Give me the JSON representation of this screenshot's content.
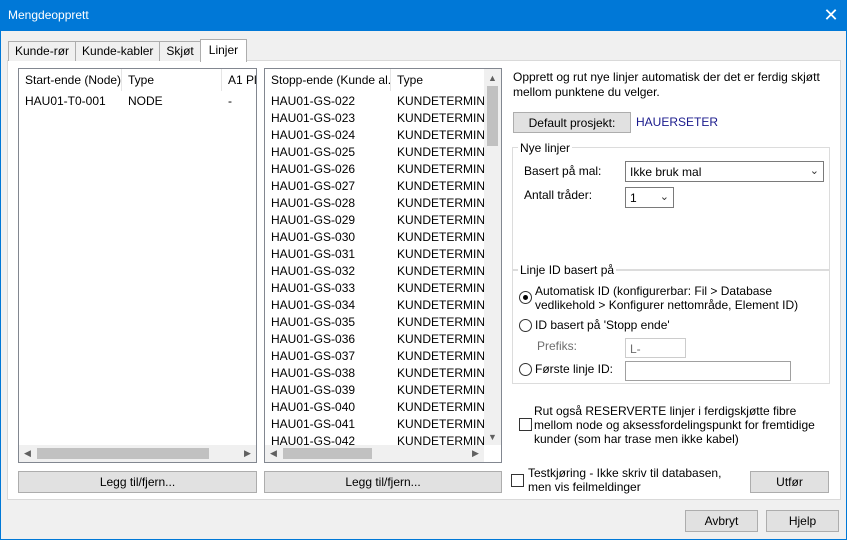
{
  "window": {
    "title": "Mengdeopprett",
    "close_glyph": "✕"
  },
  "tabs": [
    {
      "label": "Kunde-rør"
    },
    {
      "label": "Kunde-kabler"
    },
    {
      "label": "Skjøt"
    },
    {
      "label": "Linjer",
      "active": true
    }
  ],
  "start_list": {
    "columns": [
      "Start-ende (Node)",
      "Type",
      "A1 Pl"
    ],
    "rows": [
      [
        "HAU01-T0-001",
        "NODE",
        "-"
      ]
    ],
    "button_label": "Legg til/fjern..."
  },
  "stop_list": {
    "columns": [
      "Stopp-ende (Kunde al...",
      "Type"
    ],
    "rows": [
      [
        "HAU01-GS-022",
        "KUNDETERMINE"
      ],
      [
        "HAU01-GS-023",
        "KUNDETERMINE"
      ],
      [
        "HAU01-GS-024",
        "KUNDETERMINE"
      ],
      [
        "HAU01-GS-025",
        "KUNDETERMINE"
      ],
      [
        "HAU01-GS-026",
        "KUNDETERMINE"
      ],
      [
        "HAU01-GS-027",
        "KUNDETERMINE"
      ],
      [
        "HAU01-GS-028",
        "KUNDETERMINE"
      ],
      [
        "HAU01-GS-029",
        "KUNDETERMINE"
      ],
      [
        "HAU01-GS-030",
        "KUNDETERMINE"
      ],
      [
        "HAU01-GS-031",
        "KUNDETERMINE"
      ],
      [
        "HAU01-GS-032",
        "KUNDETERMINE"
      ],
      [
        "HAU01-GS-033",
        "KUNDETERMINE"
      ],
      [
        "HAU01-GS-034",
        "KUNDETERMINE"
      ],
      [
        "HAU01-GS-035",
        "KUNDETERMINE"
      ],
      [
        "HAU01-GS-036",
        "KUNDETERMINE"
      ],
      [
        "HAU01-GS-037",
        "KUNDETERMINE"
      ],
      [
        "HAU01-GS-038",
        "KUNDETERMINE"
      ],
      [
        "HAU01-GS-039",
        "KUNDETERMINE"
      ],
      [
        "HAU01-GS-040",
        "KUNDETERMINE"
      ],
      [
        "HAU01-GS-041",
        "KUNDETERMINE"
      ],
      [
        "HAU01-GS-042",
        "KUNDETERMINE"
      ]
    ],
    "button_label": "Legg til/fjern..."
  },
  "right": {
    "description": "Opprett og rut nye linjer automatisk der det er ferdig skjøtt mellom punktene du velger.",
    "default_project_button": "Default prosjekt:",
    "default_project_value": "HAUERSETER",
    "new_lines": {
      "title": "Nye linjer",
      "template_label": "Basert på mal:",
      "template_value": "Ikke bruk mal",
      "threads_label": "Antall tråder:",
      "threads_value": "1"
    },
    "line_id": {
      "title": "Linje ID basert på",
      "auto_label": "Automatisk ID (konfigurerbar: Fil > Database vedlikehold > Konfigurer nettområde, Element ID)",
      "stop_label": "ID basert på 'Stopp ende'",
      "prefix_label": "Prefiks:",
      "prefix_value": "L-",
      "first_label": "Første linje ID:",
      "first_value": ""
    },
    "reserved_label": "Rut også RESERVERTE linjer i ferdigskjøtte fibre mellom node og aksessfordelingspunkt for fremtidige kunder (som har trase men ikke kabel)",
    "test_label": "Testkjøring - Ikke skriv til databasen, men vis feilmeldinger",
    "execute_button": "Utfør"
  },
  "footer": {
    "cancel": "Avbryt",
    "help": "Hjelp"
  }
}
